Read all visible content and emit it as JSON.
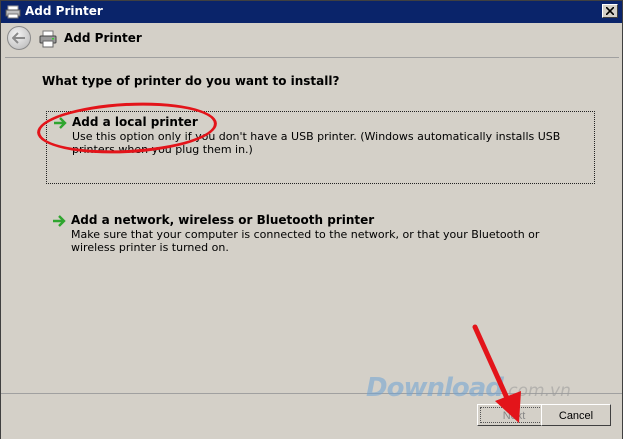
{
  "window": {
    "title": "Add Printer"
  },
  "header": {
    "title": "Add Printer"
  },
  "main": {
    "question": "What type of printer do you want to install?",
    "options": [
      {
        "title": "Add a local printer",
        "description": "Use this option only if you don't have a USB printer. (Windows automatically installs USB printers when you plug them in.)"
      },
      {
        "title": "Add a network, wireless or Bluetooth printer",
        "description": "Make sure that your computer is connected to the network, or that your Bluetooth or wireless printer is turned on."
      }
    ]
  },
  "footer": {
    "next_label": "Next",
    "cancel_label": "Cancel"
  },
  "watermark": {
    "brand": "Download",
    "tld": ".com.vn"
  },
  "colors": {
    "titlebar": "#0a246a",
    "face": "#d4d0c8",
    "annotation_red": "#e3141a",
    "option_arrow": "#2fa52f"
  }
}
